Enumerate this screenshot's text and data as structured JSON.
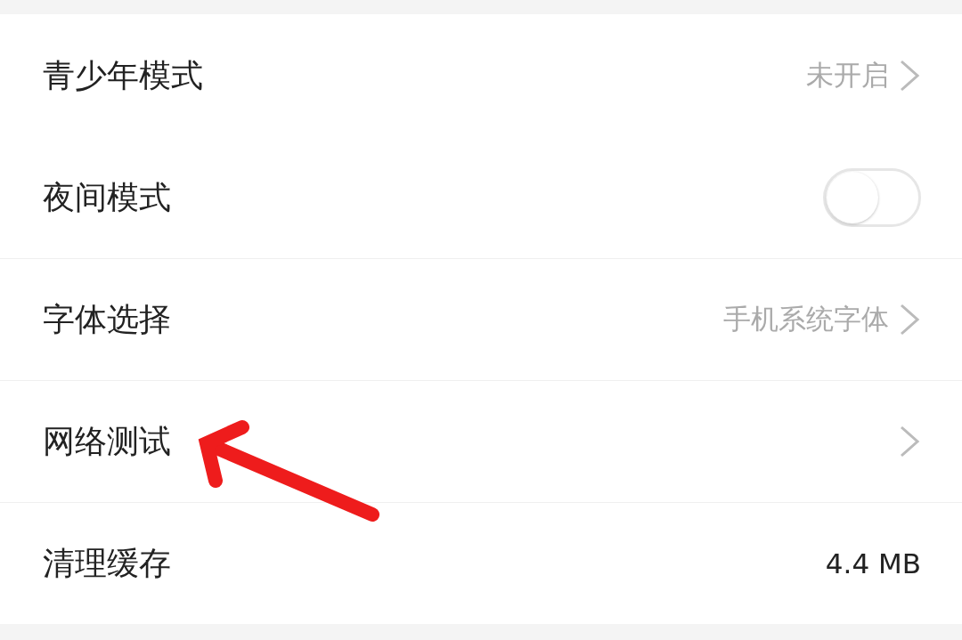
{
  "settings": [
    {
      "kind": "link",
      "label": "青少年模式",
      "value": "未开启",
      "divider": false
    },
    {
      "kind": "toggle",
      "label": "夜间模式",
      "on": false,
      "divider": false
    },
    {
      "kind": "link",
      "label": "字体选择",
      "value": "手机系统字体",
      "divider": true
    },
    {
      "kind": "link",
      "label": "网络测试",
      "divider": true
    },
    {
      "kind": "value",
      "label": "清理缓存",
      "value": "4.4 MB",
      "divider": true
    }
  ]
}
